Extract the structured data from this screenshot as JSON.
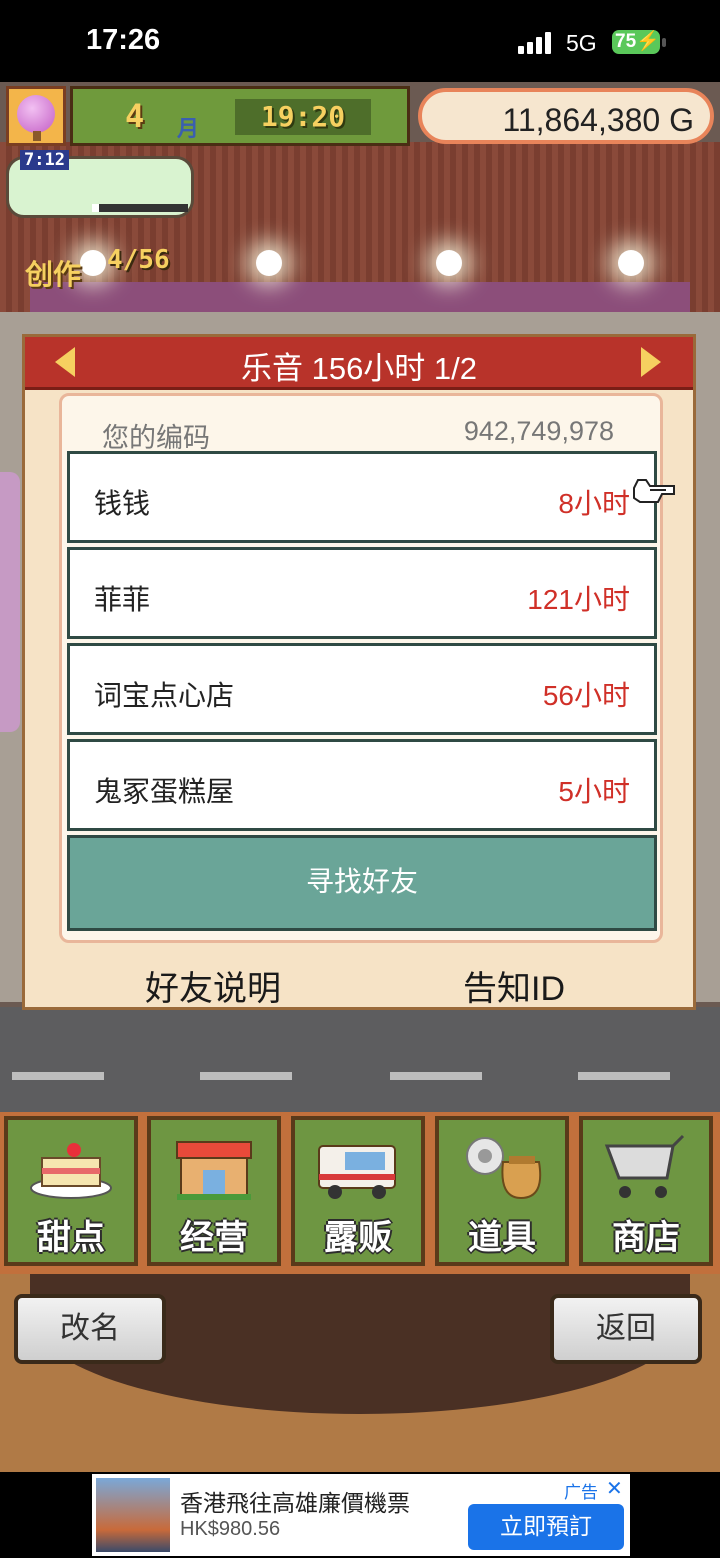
{
  "status_bar": {
    "time": "17:26",
    "network": "5G",
    "battery": "75"
  },
  "hud": {
    "month_number": "4",
    "month_unit": "月",
    "clock": "19:20",
    "money": "11,864,380 G",
    "create_timer": "7:12",
    "create_label": "创作",
    "create_count": "4/56",
    "create_progress": 0.07
  },
  "dialog": {
    "title": "乐音  156小时 1/2",
    "code_label": "您的编码",
    "code_value": "942,749,978",
    "friends": [
      {
        "name": "钱钱",
        "hours": "8小时"
      },
      {
        "name": "菲菲",
        "hours": "121小时"
      },
      {
        "name": "词宝点心店",
        "hours": "56小时"
      },
      {
        "name": "鬼冢蛋糕屋",
        "hours": "5小时"
      }
    ],
    "find_friend": "寻找好友",
    "help_link": "好友说明",
    "notify_link": "告知ID"
  },
  "menu": {
    "items": [
      {
        "label": "甜点",
        "icon": "cake-icon"
      },
      {
        "label": "经营",
        "icon": "shop-icon"
      },
      {
        "label": "露贩",
        "icon": "food-truck-icon"
      },
      {
        "label": "道具",
        "icon": "items-bag-icon"
      },
      {
        "label": "商店",
        "icon": "shopping-cart-icon"
      }
    ]
  },
  "actions": {
    "rename": "改名",
    "back": "返回"
  },
  "ad": {
    "title": "香港飛往高雄廉價機票",
    "price": "HK$980.56",
    "tag": "广告",
    "close": "✕",
    "cta": "立即預訂"
  }
}
